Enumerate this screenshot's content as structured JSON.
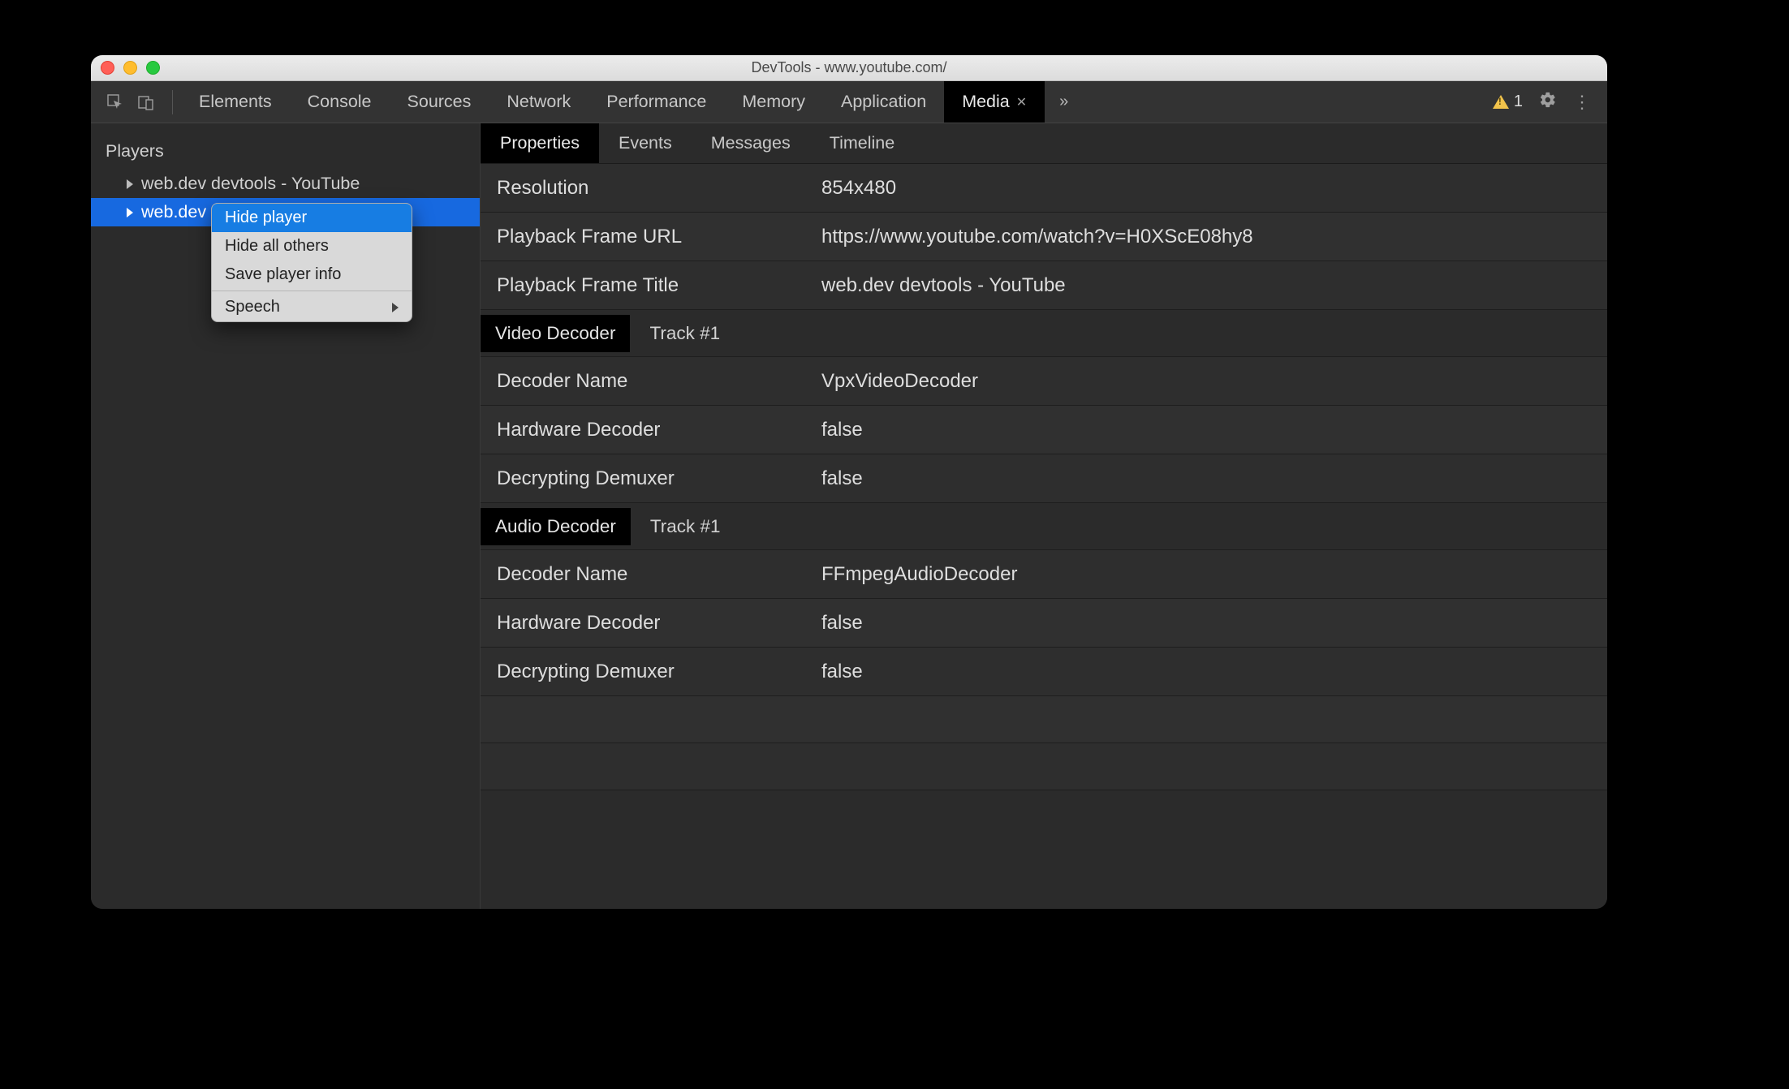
{
  "window": {
    "title": "DevTools - www.youtube.com/"
  },
  "toolbar": {
    "tabs": [
      "Elements",
      "Console",
      "Sources",
      "Network",
      "Performance",
      "Memory",
      "Application",
      "Media"
    ],
    "active_tab_index": 7,
    "warning_count": "1"
  },
  "sidebar": {
    "title": "Players",
    "items": [
      {
        "label": "web.dev devtools - YouTube"
      },
      {
        "label": "web.dev devtools - YouTube"
      }
    ],
    "selected_index": 1
  },
  "context_menu": {
    "items": [
      {
        "label": "Hide player",
        "highlighted": true
      },
      {
        "label": "Hide all others"
      },
      {
        "label": "Save player info"
      }
    ],
    "submenu_label": "Speech"
  },
  "subtabs": {
    "items": [
      "Properties",
      "Events",
      "Messages",
      "Timeline"
    ],
    "active_index": 0
  },
  "properties": {
    "top": [
      {
        "label": "Resolution",
        "value": "854x480"
      },
      {
        "label": "Playback Frame URL",
        "value": "https://www.youtube.com/watch?v=H0XScE08hy8"
      },
      {
        "label": "Playback Frame Title",
        "value": "web.dev devtools - YouTube"
      }
    ],
    "video_section": {
      "chip": "Video Decoder",
      "track": "Track #1"
    },
    "video": [
      {
        "label": "Decoder Name",
        "value": "VpxVideoDecoder"
      },
      {
        "label": "Hardware Decoder",
        "value": "false"
      },
      {
        "label": "Decrypting Demuxer",
        "value": "false"
      }
    ],
    "audio_section": {
      "chip": "Audio Decoder",
      "track": "Track #1"
    },
    "audio": [
      {
        "label": "Decoder Name",
        "value": "FFmpegAudioDecoder"
      },
      {
        "label": "Hardware Decoder",
        "value": "false"
      },
      {
        "label": "Decrypting Demuxer",
        "value": "false"
      }
    ]
  }
}
